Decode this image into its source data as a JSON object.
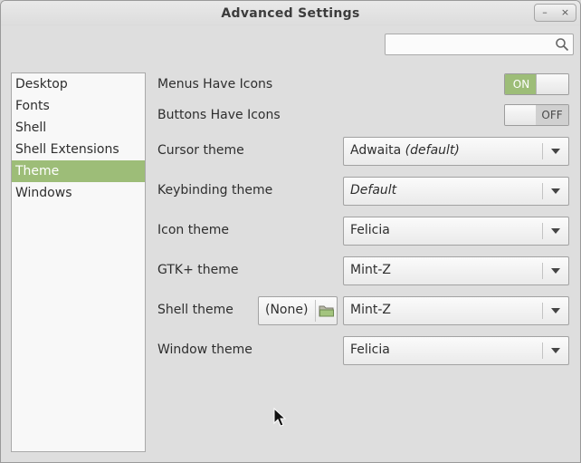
{
  "window": {
    "title": "Advanced Settings",
    "minimize": "–",
    "close": "×"
  },
  "search": {
    "value": "",
    "placeholder": ""
  },
  "sidebar": {
    "items": [
      {
        "label": "Desktop",
        "selected": false
      },
      {
        "label": "Fonts",
        "selected": false
      },
      {
        "label": "Shell",
        "selected": false
      },
      {
        "label": "Shell Extensions",
        "selected": false
      },
      {
        "label": "Theme",
        "selected": true
      },
      {
        "label": "Windows",
        "selected": false
      }
    ]
  },
  "settings": {
    "menus_icons": {
      "label": "Menus Have Icons",
      "state": "ON"
    },
    "buttons_icons": {
      "label": "Buttons Have Icons",
      "state": "OFF"
    },
    "cursor_theme": {
      "label": "Cursor theme",
      "value": "Adwaita",
      "suffix": "(default)"
    },
    "keybinding_theme": {
      "label": "Keybinding theme",
      "value": "Default"
    },
    "icon_theme": {
      "label": "Icon theme",
      "value": "Felicia"
    },
    "gtk_theme": {
      "label": "GTK+ theme",
      "value": "Mint-Z"
    },
    "shell_theme": {
      "label": "Shell theme",
      "file_button": "(None)",
      "value": "Mint-Z"
    },
    "window_theme": {
      "label": "Window theme",
      "value": "Felicia"
    }
  },
  "colors": {
    "accent": "#9dbd78",
    "background": "#dedede",
    "sidebar_bg": "#f8f8f8"
  },
  "icons": {
    "search": "search-icon",
    "folder": "folder-icon",
    "dropdown": "chevron-down-icon"
  }
}
